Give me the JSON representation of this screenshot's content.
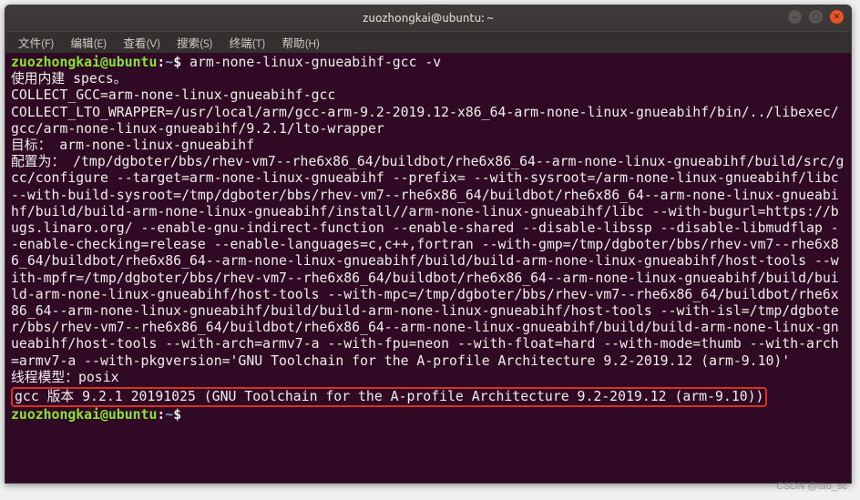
{
  "window": {
    "title": "zuozhongkai@ubuntu: ~"
  },
  "menu": {
    "file": "文件(F)",
    "edit": "编辑(E)",
    "view": "查看(V)",
    "search": "搜索(S)",
    "term": "终端(T)",
    "help": "帮助(H)"
  },
  "prompt": {
    "userhost": "zuozhongkai@ubuntu",
    "sep": ":",
    "path": "~",
    "sigil": "$"
  },
  "command": "arm-none-linux-gnueabihf-gcc -v",
  "output": {
    "line1": "使用内建 specs。",
    "line2": "COLLECT_GCC=arm-none-linux-gnueabihf-gcc",
    "line3": "COLLECT_LTO_WRAPPER=/usr/local/arm/gcc-arm-9.2-2019.12-x86_64-arm-none-linux-gnueabihf/bin/../libexec/gcc/arm-none-linux-gnueabihf/9.2.1/lto-wrapper",
    "line4": "目标： arm-none-linux-gnueabihf",
    "line5": "配置为： /tmp/dgboter/bbs/rhev-vm7--rhe6x86_64/buildbot/rhe6x86_64--arm-none-linux-gnueabihf/build/src/gcc/configure --target=arm-none-linux-gnueabihf --prefix= --with-sysroot=/arm-none-linux-gnueabihf/libc --with-build-sysroot=/tmp/dgboter/bbs/rhev-vm7--rhe6x86_64/buildbot/rhe6x86_64--arm-none-linux-gnueabihf/build/build-arm-none-linux-gnueabihf/install//arm-none-linux-gnueabihf/libc --with-bugurl=https://bugs.linaro.org/ --enable-gnu-indirect-function --enable-shared --disable-libssp --disable-libmudflap --enable-checking=release --enable-languages=c,c++,fortran --with-gmp=/tmp/dgboter/bbs/rhev-vm7--rhe6x86_64/buildbot/rhe6x86_64--arm-none-linux-gnueabihf/build/build-arm-none-linux-gnueabihf/host-tools --with-mpfr=/tmp/dgboter/bbs/rhev-vm7--rhe6x86_64/buildbot/rhe6x86_64--arm-none-linux-gnueabihf/build/build-arm-none-linux-gnueabihf/host-tools --with-mpc=/tmp/dgboter/bbs/rhev-vm7--rhe6x86_64/buildbot/rhe6x86_64--arm-none-linux-gnueabihf/build/build-arm-none-linux-gnueabihf/host-tools --with-isl=/tmp/dgboter/bbs/rhev-vm7--rhe6x86_64/buildbot/rhe6x86_64--arm-none-linux-gnueabihf/build/build-arm-none-linux-gnueabihf/host-tools --with-arch=armv7-a --with-fpu=neon --with-float=hard --with-mode=thumb --with-arch=armv7-a --with-pkgversion='GNU Toolchain for the A-profile Architecture 9.2-2019.12 (arm-9.10)'",
    "line6": "线程模型：posix",
    "line7": "gcc 版本 9.2.1 20191025 (GNU Toolchain for the A-profile Architecture 9.2-2019.12 (arm-9.10))"
  },
  "watermark": "CSDN @tao_sc"
}
